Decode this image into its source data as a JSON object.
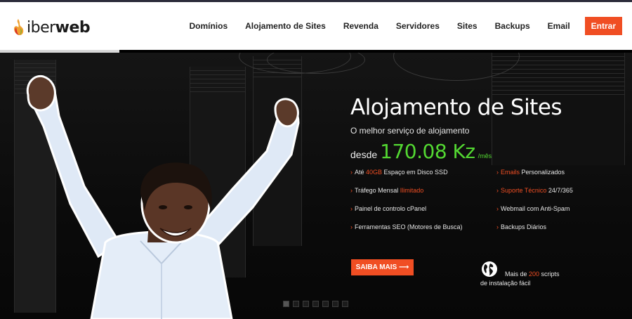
{
  "brand": {
    "logo_light": "iber",
    "logo_bold": "web"
  },
  "nav": {
    "items": [
      "Domínios",
      "Alojamento de Sites",
      "Revenda",
      "Servidores",
      "Sites",
      "Backups",
      "Email"
    ],
    "cta_label": "Entrar"
  },
  "colors": {
    "accent": "#f04e23",
    "price": "#53d832",
    "header_bg": "#ffffff",
    "hero_bg": "#0b0b0b"
  },
  "hero": {
    "title": "Alojamento de Sites",
    "subtitle": "O melhor serviço de alojamento",
    "price_prefix": "desde",
    "price_value": "170.08 Kz",
    "price_unit": "/mês",
    "features_left": [
      {
        "before": "Até ",
        "highlight": "40GB",
        "after": " Espaço em Disco SSD"
      },
      {
        "before": "Tráfego Mensal ",
        "highlight": "Ilimitado",
        "after": ""
      },
      {
        "before": "Painel de controlo cPanel",
        "highlight": "",
        "after": ""
      },
      {
        "before": "Ferramentas SEO (Motores de Busca)",
        "highlight": "",
        "after": ""
      }
    ],
    "features_right": [
      {
        "before": "",
        "highlight": "Emails",
        "after": " Personalizados"
      },
      {
        "before": "",
        "highlight": "Suporte Técnico",
        "after": " 24/7/365"
      },
      {
        "before": "Webmail com Anti-Spam",
        "highlight": "",
        "after": ""
      },
      {
        "before": "Backups Diários",
        "highlight": "",
        "after": ""
      }
    ],
    "cta_label": "SAIBA MAIS ⟶",
    "scripts": {
      "before": "Mais de ",
      "highlight": "200",
      "after": " scripts",
      "line2": "de instalação fácil"
    },
    "slider_count": 7,
    "slider_active": 0
  }
}
